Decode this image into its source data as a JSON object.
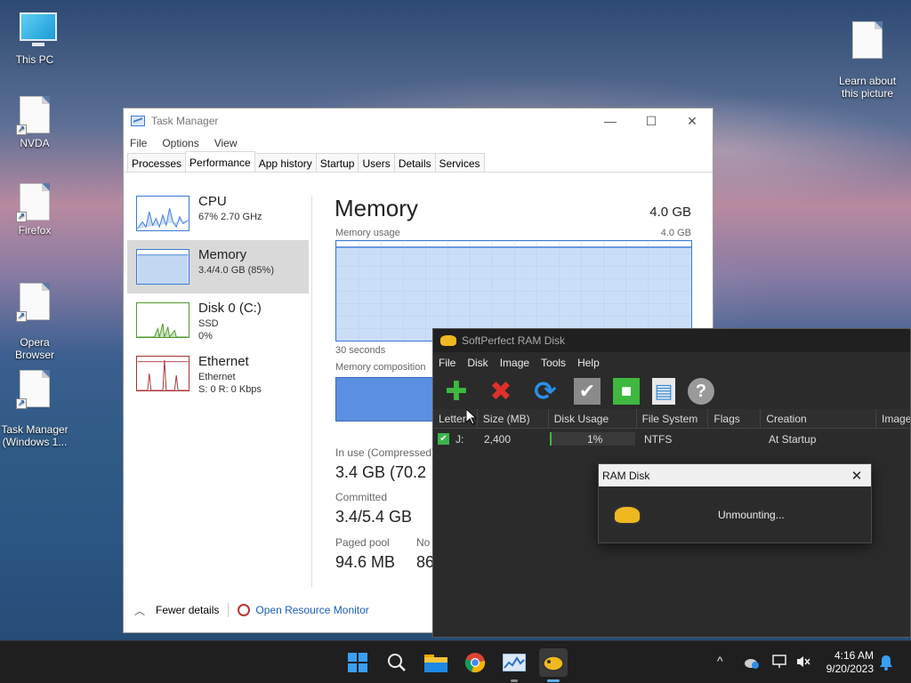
{
  "desktop": {
    "icons": [
      {
        "label": "This PC"
      },
      {
        "label": "NVDA"
      },
      {
        "label": "Firefox"
      },
      {
        "label": "Opera\nBrowser"
      },
      {
        "label": "Task Manager\n(Windows 1..."
      },
      {
        "label": "Learn about\nthis picture"
      }
    ]
  },
  "task_manager": {
    "title": "Task Manager",
    "controls": {
      "minimize": "—",
      "maximize": "☐",
      "close": "✕"
    },
    "menu": [
      "File",
      "Options",
      "View"
    ],
    "tabs": [
      "Processes",
      "Performance",
      "App history",
      "Startup",
      "Users",
      "Details",
      "Services"
    ],
    "active_tab": "Performance",
    "sidebar": [
      {
        "name": "CPU",
        "line1": "67% 2.70 GHz",
        "line2": ""
      },
      {
        "name": "Memory",
        "line1": "3.4/4.0 GB (85%)",
        "line2": ""
      },
      {
        "name": "Disk 0 (C:)",
        "line1": "SSD",
        "line2": "0%"
      },
      {
        "name": "Ethernet",
        "line1": "Ethernet",
        "line2": "S: 0 R: 0 Kbps"
      }
    ],
    "main": {
      "title": "Memory",
      "total": "4.0 GB",
      "usage_label": "Memory usage",
      "usage_max": "4.0 GB",
      "time_label": "30 seconds",
      "composition_label": "Memory composition",
      "memory_used_fraction": 0.85,
      "stats": [
        {
          "label": "In use (Compressed)",
          "value": "3.4 GB (70.2"
        },
        {
          "label": "Committed",
          "value": "3.4/5.4 GB"
        },
        {
          "label": "Paged pool",
          "value": "94.6 MB"
        },
        {
          "label": "No",
          "value": "86"
        }
      ]
    },
    "footer": {
      "fewer_details": "Fewer details",
      "resource_monitor": "Open Resource Monitor"
    }
  },
  "ramdisk": {
    "title": "SoftPerfect RAM Disk",
    "menu": [
      "File",
      "Disk",
      "Image",
      "Tools",
      "Help"
    ],
    "toolbar": [
      {
        "name": "add",
        "glyph": "✚",
        "color": "#3fb83f"
      },
      {
        "name": "remove",
        "glyph": "✖",
        "color": "#e0302a"
      },
      {
        "name": "refresh",
        "glyph": "⟳",
        "color": "#2b8fe8"
      },
      {
        "name": "apply",
        "glyph": "✔",
        "color": "#9a9a9a"
      },
      {
        "name": "stop",
        "glyph": "■",
        "color": "#3fb83f"
      },
      {
        "name": "save",
        "glyph": "▤",
        "color": "#3a8ed8"
      },
      {
        "name": "help",
        "glyph": "?",
        "color": "#d0d0d0"
      }
    ],
    "columns": [
      "Letter",
      "Size (MB)",
      "Disk Usage",
      "File System",
      "Flags",
      "Creation",
      "Image"
    ],
    "rows": [
      {
        "letter": "J:",
        "size": "2,400",
        "usage": "1%",
        "fs": "NTFS",
        "flags": "",
        "creation": "At Startup",
        "image": ""
      }
    ]
  },
  "dialog": {
    "title": "RAM Disk",
    "close": "✕",
    "message": "Unmounting..."
  },
  "taskbar": {
    "time": "4:16 AM",
    "date": "9/20/2023",
    "tray_chevron": "^"
  }
}
